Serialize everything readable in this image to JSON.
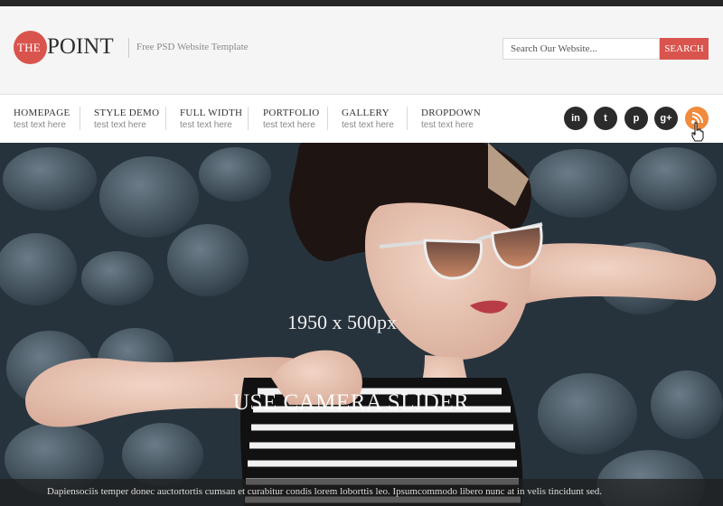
{
  "logo": {
    "prefix": "THE",
    "name": "POINT"
  },
  "header": {
    "tagline": "Free PSD Website Template"
  },
  "search": {
    "placeholder": "Search Our Website...",
    "button_label": "SEARCH"
  },
  "nav": {
    "items": [
      {
        "title": "HOMEPAGE",
        "sub": "test text here"
      },
      {
        "title": "STYLE DEMO",
        "sub": "test text here"
      },
      {
        "title": "FULL WIDTH",
        "sub": "test text here"
      },
      {
        "title": "PORTFOLIO",
        "sub": "test text here"
      },
      {
        "title": "GALLERY",
        "sub": "test text here"
      },
      {
        "title": "DROPDOWN",
        "sub": "test text here"
      }
    ]
  },
  "social": {
    "icons": [
      "linkedin-icon",
      "twitter-icon",
      "pinterest-icon",
      "google-plus-icon",
      "rss-icon"
    ],
    "labels": {
      "linkedin": "in",
      "twitter": "t",
      "pinterest": "p",
      "googleplus": "g+"
    },
    "colors": {
      "dark": "#2b2b2b",
      "rss": "#f08a3c"
    }
  },
  "hero": {
    "dimensions": "1950 x 500px",
    "title": "USE CAMERA SLIDER",
    "caption": "Dapiensociis temper donec auctortortis cumsan et curabitur condis lorem loborttis leo. Ipsumcommodo libero nunc at in velis tincidunt sed."
  },
  "colors": {
    "accent": "#d9544d",
    "topbar": "#262626"
  }
}
